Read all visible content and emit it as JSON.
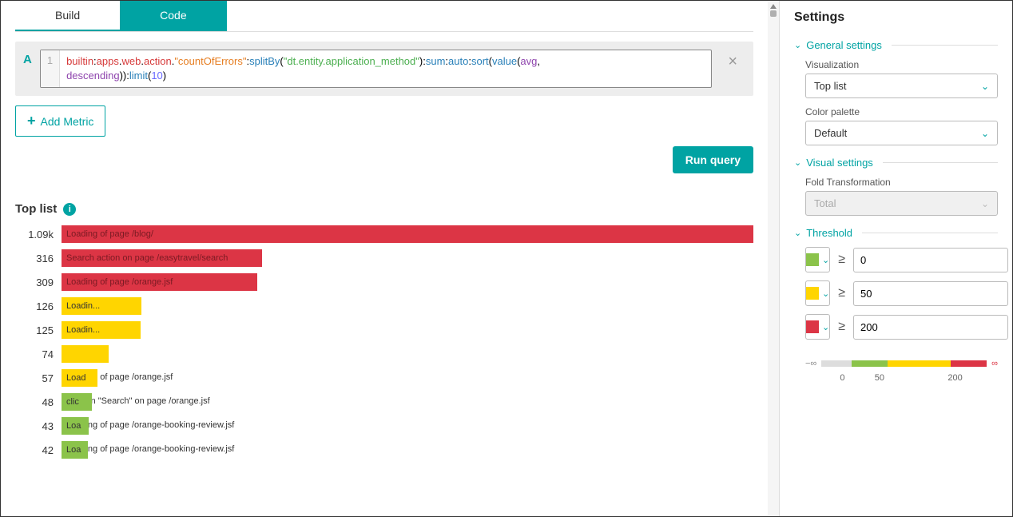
{
  "tabs": {
    "build": "Build",
    "code": "Code",
    "active": "code"
  },
  "query": {
    "label": "A",
    "line": "1",
    "raw": "builtin:apps.web.action.\"countOfErrors\":splitBy(\"dt.entity.application_method\"):sum:auto:sort(value(avg,descending)):limit(10)"
  },
  "add_metric": "Add Metric",
  "run_query": "Run query",
  "chart_title": "Top list",
  "chart_data": {
    "type": "bar",
    "orientation": "horizontal",
    "max": 1090,
    "items": [
      {
        "value": 1090,
        "display": "1.09k",
        "label": "Loading of page /blog/",
        "color": "red",
        "width_pct": 100,
        "overflow": false
      },
      {
        "value": 316,
        "display": "316",
        "label": "Search action on page /easytravel/search",
        "color": "red",
        "width_pct": 29,
        "overflow": false
      },
      {
        "value": 309,
        "display": "309",
        "label": "Loading of page /orange.jsf",
        "color": "red",
        "width_pct": 28.3,
        "overflow": false
      },
      {
        "value": 126,
        "display": "126",
        "label": "Loadin...",
        "color": "yellow",
        "width_pct": 11.5,
        "overflow": false
      },
      {
        "value": 125,
        "display": "125",
        "label": "Loadin...",
        "color": "yellow",
        "width_pct": 11.4,
        "overflow": false
      },
      {
        "value": 74,
        "display": "74",
        "label": "",
        "color": "yellow",
        "width_pct": 6.8,
        "overflow": false
      },
      {
        "value": 57,
        "display": "57",
        "label": "Loading of page /orange.jsf",
        "color": "yellow",
        "width_pct": 5.2,
        "overflow": true,
        "bar_text": "Load"
      },
      {
        "value": 48,
        "display": "48",
        "label": "click on \"Search\" on page /orange.jsf",
        "color": "green",
        "width_pct": 4.4,
        "overflow": true,
        "bar_text": "clic"
      },
      {
        "value": 43,
        "display": "43",
        "label": "Loading of page /orange-booking-review.jsf",
        "color": "green",
        "width_pct": 3.9,
        "overflow": true,
        "bar_text": "Loa"
      },
      {
        "value": 42,
        "display": "42",
        "label": "Loading of page /orange-booking-review.jsf",
        "color": "green",
        "width_pct": 3.8,
        "overflow": true,
        "bar_text": "Loa"
      }
    ]
  },
  "settings": {
    "title": "Settings",
    "general": {
      "title": "General settings",
      "visualization_label": "Visualization",
      "visualization_value": "Top list",
      "palette_label": "Color palette",
      "palette_value": "Default",
      "palette_colors": [
        "#6b3fa0",
        "#00bcd4"
      ]
    },
    "visual": {
      "title": "Visual settings",
      "fold_label": "Fold Transformation",
      "fold_value": "Total"
    },
    "threshold": {
      "title": "Threshold",
      "items": [
        {
          "color": "#8bc34a",
          "op": "≥",
          "value": "0"
        },
        {
          "color": "#ffd500",
          "op": "≥",
          "value": "50"
        },
        {
          "color": "#dc3545",
          "op": "≥",
          "value": "200"
        }
      ],
      "gradient": {
        "minus_inf": "−∞",
        "plus_inf": "∞",
        "ticks": [
          "0",
          "50",
          "200"
        ]
      }
    }
  }
}
